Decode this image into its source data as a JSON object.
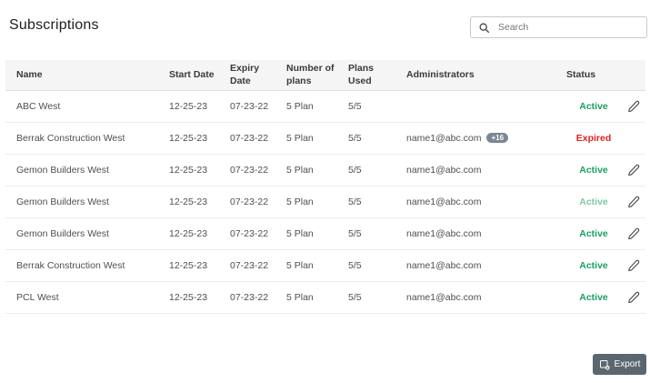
{
  "page": {
    "title": "Subscriptions"
  },
  "search": {
    "placeholder": "Search",
    "icon": "search-icon"
  },
  "table": {
    "columns": [
      "Name",
      "Start Date",
      "Expiry Date",
      "Number of plans",
      "Plans Used",
      "Administrators",
      "Status"
    ],
    "rows": [
      {
        "name": "ABC West",
        "start_date": "12-25-23",
        "expiry_date": "07-23-22",
        "number_of_plans": "5 Plan",
        "plans_used": "5/5",
        "administrators": "",
        "admin_badge": "",
        "status": "Active",
        "status_color": "#19a15e",
        "editable": true
      },
      {
        "name": "Berrak Construction West",
        "start_date": "12-25-23",
        "expiry_date": "07-23-22",
        "number_of_plans": "5 Plan",
        "plans_used": "5/5",
        "administrators": "name1@abc.com",
        "admin_badge": "+16",
        "status": "Expired",
        "status_color": "#e02020",
        "editable": false
      },
      {
        "name": "Gemon Builders West",
        "start_date": "12-25-23",
        "expiry_date": "07-23-22",
        "number_of_plans": "5 Plan",
        "plans_used": "5/5",
        "administrators": "name1@abc.com",
        "admin_badge": "",
        "status": "Active",
        "status_color": "#19a15e",
        "editable": true
      },
      {
        "name": "Gemon Builders West",
        "start_date": "12-25-23",
        "expiry_date": "07-23-22",
        "number_of_plans": "5 Plan",
        "plans_used": "5/5",
        "administrators": "name1@abc.com",
        "admin_badge": "",
        "status": "Active",
        "status_color": "#7fc8a3",
        "editable": true
      },
      {
        "name": "Gemon Builders West",
        "start_date": "12-25-23",
        "expiry_date": "07-23-22",
        "number_of_plans": "5 Plan",
        "plans_used": "5/5",
        "administrators": "name1@abc.com",
        "admin_badge": "",
        "status": "Active",
        "status_color": "#19a15e",
        "editable": true
      },
      {
        "name": "Berrak Construction West",
        "start_date": "12-25-23",
        "expiry_date": "07-23-22",
        "number_of_plans": "5 Plan",
        "plans_used": "5/5",
        "administrators": "name1@abc.com",
        "admin_badge": "",
        "status": "Active",
        "status_color": "#19a15e",
        "editable": true
      },
      {
        "name": "PCL West",
        "start_date": "12-25-23",
        "expiry_date": "07-23-22",
        "number_of_plans": "5 Plan",
        "plans_used": "5/5",
        "administrators": "name1@abc.com",
        "admin_badge": "",
        "status": "Active",
        "status_color": "#19a15e",
        "editable": true
      }
    ]
  },
  "export_button": {
    "label": "Export",
    "icon": "export-icon"
  },
  "colors": {
    "active_green": "#19a15e",
    "active_green_light": "#7fc8a3",
    "expired_red": "#e02020",
    "badge_gray": "#7b8794",
    "export_bg": "#5b6770",
    "header_bg": "#f5f5f5"
  }
}
